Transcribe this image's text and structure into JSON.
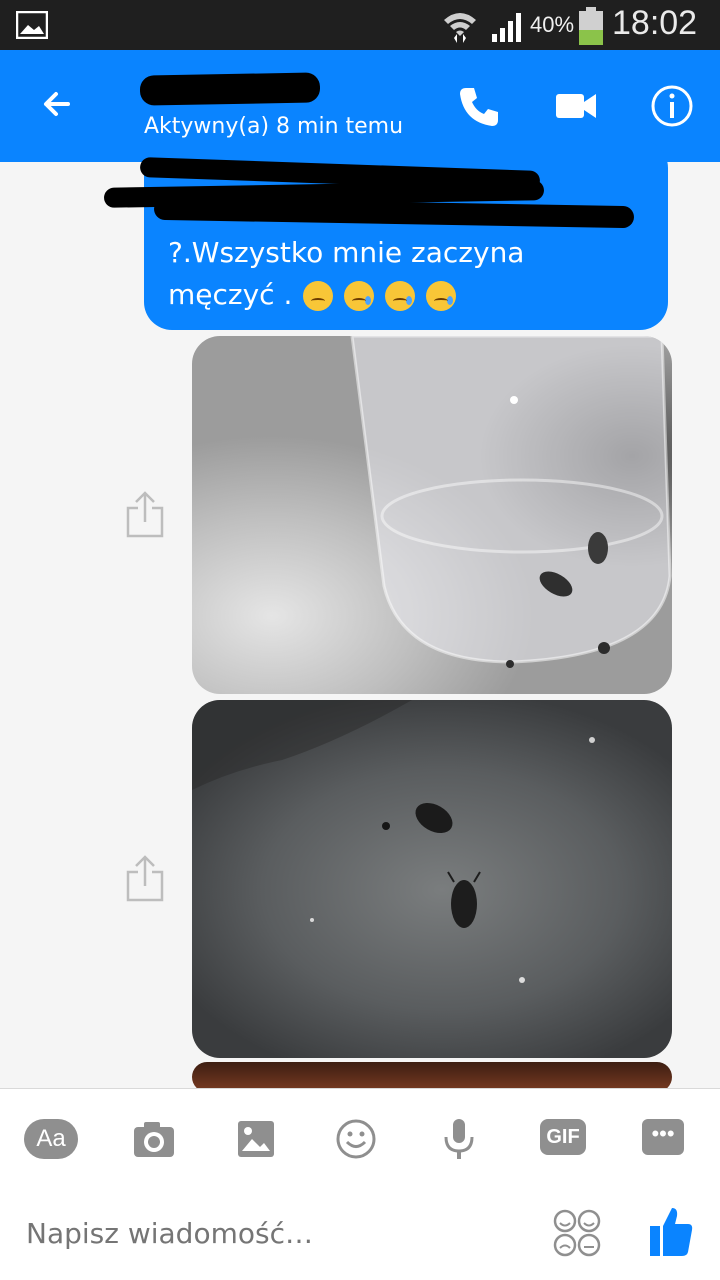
{
  "status_bar": {
    "battery": "40%",
    "time": "18:02",
    "icons": [
      "gallery-icon",
      "wifi-icon",
      "signal-icon",
      "battery-icon"
    ]
  },
  "header": {
    "active_status": "Aktywny(a) 8 min temu",
    "icons": [
      "back-arrow-icon",
      "phone-icon",
      "video-camera-icon",
      "info-icon"
    ],
    "accent": "#0a84ff"
  },
  "messages": [
    {
      "type": "text",
      "text": "?.Wszystko mnie zaczyna męczyć .",
      "emojis": [
        "disappointed-face-emoji",
        "crying-face-emoji",
        "crying-face-emoji",
        "crying-face-emoji"
      ],
      "bubble_color": "#0a84ff"
    },
    {
      "type": "photo",
      "subject": "insects-in-glass-jar-photo"
    },
    {
      "type": "photo",
      "subject": "insects-on-concrete-photo"
    },
    {
      "type": "photo",
      "subject": "partially-visible-photo"
    }
  ],
  "toolbar": {
    "text_mode": "Aa",
    "gif": "GIF",
    "more": "•••",
    "icons": [
      "camera-icon",
      "image-icon",
      "emoji-icon",
      "microphone-icon"
    ]
  },
  "composer": {
    "placeholder": "Napisz wiadomość…",
    "icons": [
      "stickers-icon",
      "thumbs-up-icon"
    ]
  }
}
